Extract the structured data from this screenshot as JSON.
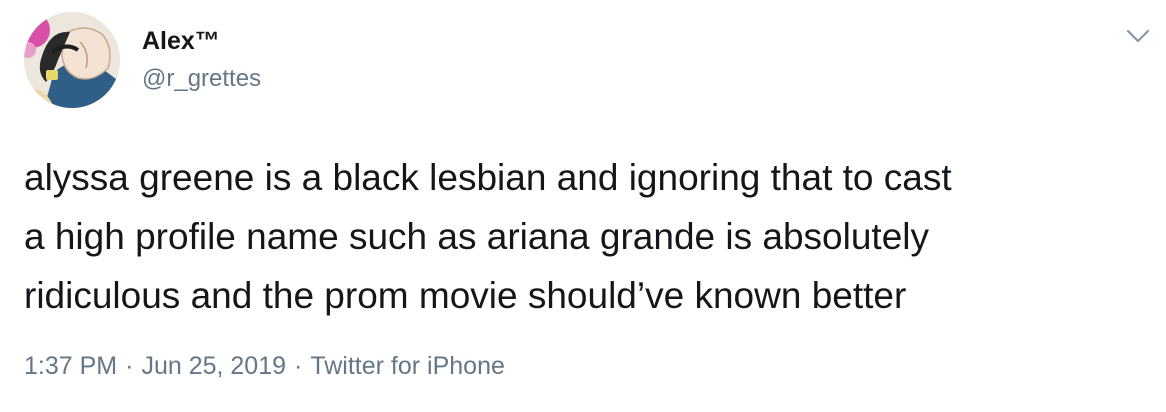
{
  "tweet": {
    "author": {
      "display_name": "Alex™",
      "handle": "@r_grettes",
      "avatar_icon": "anime-avatar-icon"
    },
    "menu_icon": "chevron-down-icon",
    "text_lines": [
      "alyssa greene is a black lesbian and ignoring that to cast",
      "a high profile name such as ariana grande is absolutely",
      "ridiculous and the prom movie should’ve known better"
    ],
    "time": "1:37 PM",
    "separator": "·",
    "date": "Jun 25, 2019",
    "source": "Twitter for iPhone"
  },
  "colors": {
    "text_primary": "#14171a",
    "text_secondary": "#657786",
    "caret": "#8899a6"
  }
}
